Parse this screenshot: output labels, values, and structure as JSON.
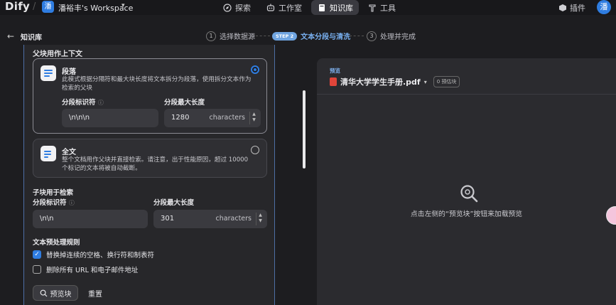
{
  "app": {
    "logo": "Dify",
    "workspace_avatar": "潘",
    "workspace_name": "潘裕丰's Workspace",
    "user_avatar": "潘"
  },
  "nav": {
    "explore": "探索",
    "studio": "工作室",
    "knowledge": "知识库",
    "tools": "工具",
    "plugins": "插件"
  },
  "breadcrumb": {
    "title": "知识库"
  },
  "steps": [
    {
      "num": "1",
      "label": "选择数据源"
    },
    {
      "num": "STEP 2",
      "label": "文本分段与清洗"
    },
    {
      "num": "3",
      "label": "处理并完成"
    }
  ],
  "left": {
    "parent_title": "父块用作上下文",
    "paragraph": {
      "title": "段落",
      "desc": "此模式根据分隔符和最大块长度将文本拆分为段落，使用拆分文本作为检索的父块",
      "sep_label": "分段标识符",
      "sep_value": "\\n\\n\\n",
      "max_label": "分段最大长度",
      "max_value": "1280",
      "units": "characters"
    },
    "fulltext": {
      "title": "全文",
      "desc": "整个文档用作父块并直接检索。请注意，出于性能原因，超过 10000 个标记的文本将被自动截断。"
    },
    "child_title": "子块用于检索",
    "child": {
      "sep_label": "分段标识符",
      "sep_value": "\\n\\n",
      "max_label": "分段最大长度",
      "max_value": "301",
      "units": "characters"
    },
    "preprocess_title": "文本预处理规则",
    "rule1": "替换掉连续的空格、换行符和制表符",
    "rule2": "删除所有 URL 和电子邮件地址",
    "preview_btn": "预览块",
    "reset_btn": "重置"
  },
  "right": {
    "sub": "预览",
    "file": "清华大学学生手册.pdf",
    "chunks": "0 预估块",
    "empty": "点击左侧的“预览块”按钮来加载预览"
  },
  "colors": {
    "accent": "#2f7de1",
    "bg": "#1d1d20"
  }
}
